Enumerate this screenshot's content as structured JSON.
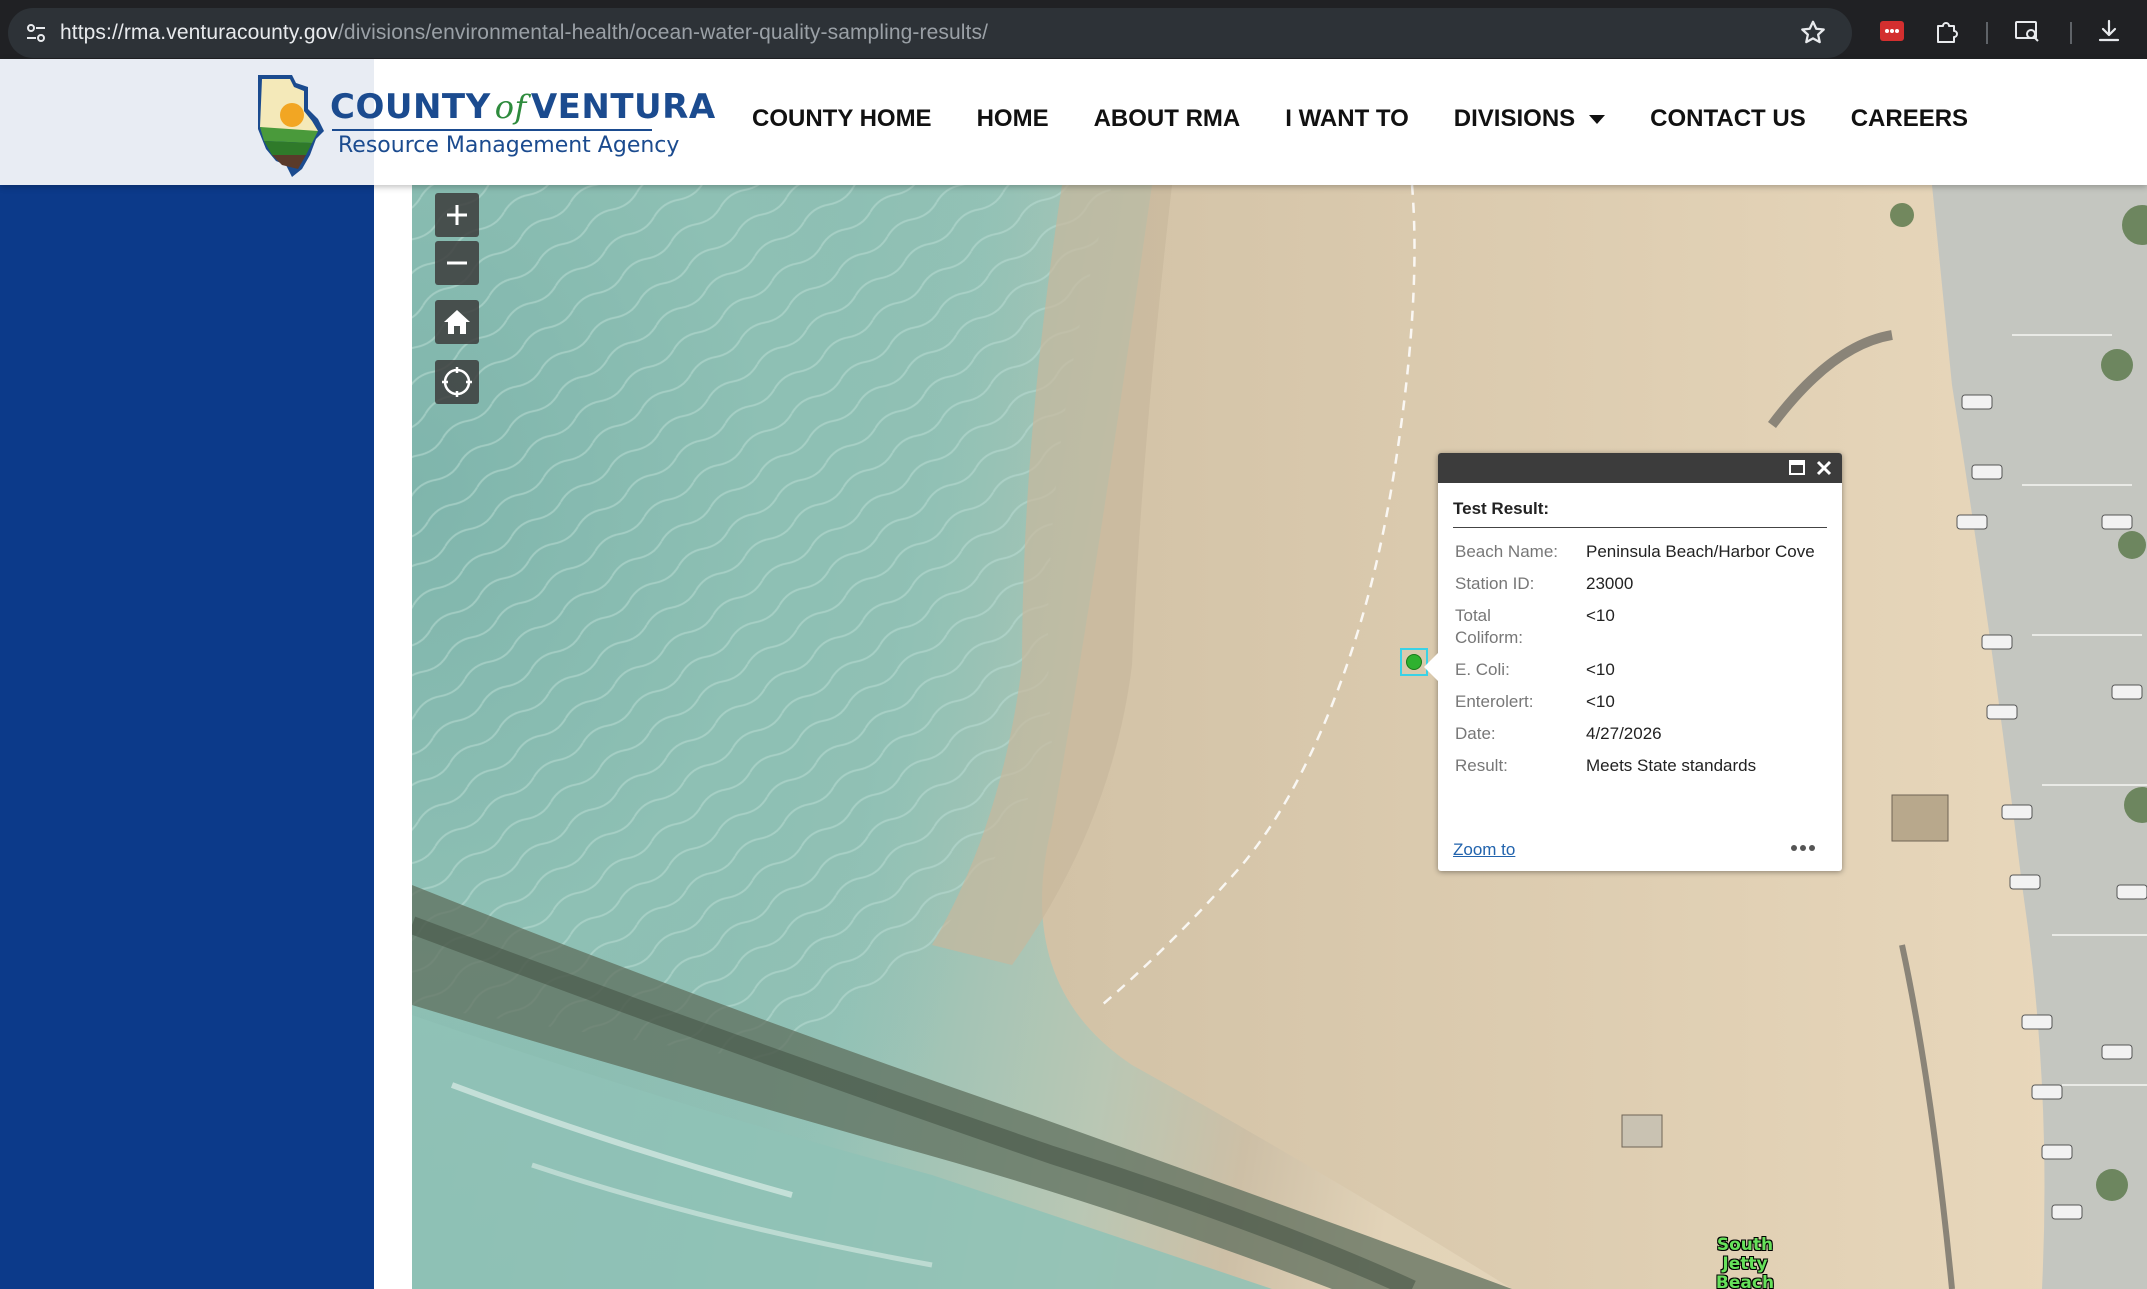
{
  "browser": {
    "url_host": "https://rma.venturacounty.gov",
    "url_path": "/divisions/environmental-health/ocean-water-quality-sampling-results/"
  },
  "site": {
    "logo_county": "COUNTY",
    "logo_of": "of",
    "logo_ventura": "VENTURA",
    "logo_subtitle": "Resource Management Agency",
    "nav": [
      "COUNTY HOME",
      "HOME",
      "ABOUT RMA",
      "I WANT TO",
      "DIVISIONS",
      "CONTACT US",
      "CAREERS"
    ]
  },
  "map": {
    "controls": [
      "zoom-in-icon",
      "zoom-out-icon",
      "home-icon",
      "locate-icon"
    ],
    "label": "South\nJetty\nBeach",
    "marker_color": "#2fb12f"
  },
  "popup": {
    "title": "Test Result:",
    "fields": [
      {
        "label": "Beach Name:",
        "value": "Peninsula Beach/Harbor Cove"
      },
      {
        "label": "Station ID:",
        "value": "23000"
      },
      {
        "label": "Total Coliform:",
        "value": "<10"
      },
      {
        "label": "E. Coli:",
        "value": "<10"
      },
      {
        "label": "Enterolert:",
        "value": "<10"
      },
      {
        "label": "Date:",
        "value": "4/27/2026"
      },
      {
        "label": "Result:",
        "value": "Meets State standards"
      }
    ],
    "zoom_link": "Zoom to"
  },
  "colors": {
    "sidebar": "#0c3a8a",
    "brand_blue": "#1b4b8f",
    "brand_green": "#2e8b3d"
  }
}
